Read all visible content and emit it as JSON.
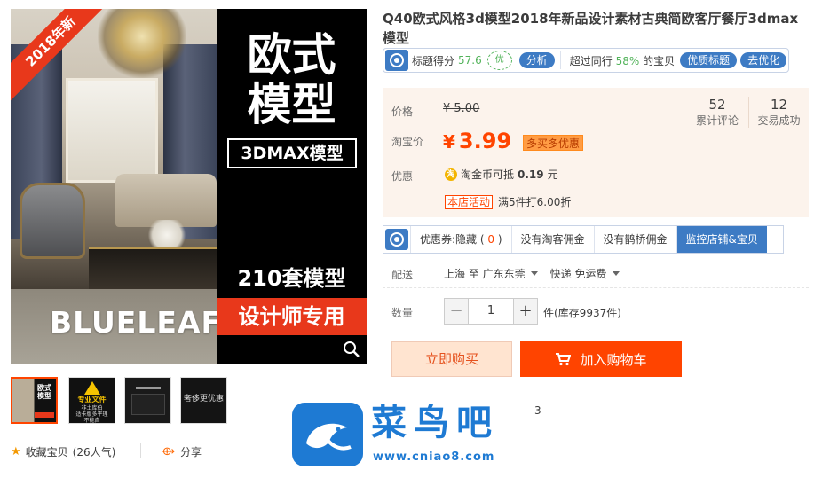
{
  "image": {
    "ribbon": "2018年新",
    "title_line1": "欧式",
    "title_line2": "模型",
    "badge": "3DMAX模型",
    "sets": "210套模型",
    "designer": "设计师专用",
    "brand": "BLUELEAF",
    "zoom_icon": "search-icon"
  },
  "thumbnails": [
    {
      "mini_line1": "欧式",
      "mini_line2": "模型"
    },
    {
      "line1": "专业文件",
      "line2": "非土库伯",
      "line3": "适卡版多平理",
      "line4": "不能自"
    },
    {
      "caption": ""
    },
    {
      "caption": "奢侈更优惠"
    }
  ],
  "actions": {
    "favorite": "收藏宝贝",
    "favorite_count": "(26人气)",
    "share": "分享"
  },
  "product": {
    "title": "Q40欧式风格3d模型2018年新品设计素材古典简欧客厅餐厅3dmax模型"
  },
  "tagbar": {
    "score_label": "标题得分",
    "score": "57.6",
    "badge": "优",
    "analyze": "分析",
    "beyond_label": "超过同行",
    "beyond_pct": "58%",
    "beyond_suffix": "的宝贝",
    "quality_title": "优质标题",
    "optimize": "去优化"
  },
  "price": {
    "price_label": "价格",
    "original": "¥ 5.00",
    "taobao_label": "淘宝价",
    "currency": "¥",
    "current": "3.99",
    "promo_tag": "多买多优惠",
    "reviews_count": "52",
    "reviews_label": "累计评论",
    "trades_count": "12",
    "trades_label": "交易成功",
    "discount_label": "优惠",
    "coin_icon": "淘",
    "coin_text": "淘金币可抵",
    "coin_amount": "0.19",
    "coin_unit": "元",
    "shop_activity": "本店活动",
    "shop_activity_desc": "满5件打6.00折"
  },
  "service": {
    "coupon": "优惠券:隐藏",
    "coupon_count": "0",
    "no_taoke": "没有淘客佣金",
    "no_queqiao": "没有鹊桥佣金",
    "monitor": "监控店铺&宝贝"
  },
  "delivery": {
    "label": "配送",
    "from": "上海 至",
    "to": "广东东莞",
    "method": "快递 免运费"
  },
  "quantity": {
    "label": "数量",
    "minus": "−",
    "value": "1",
    "plus": "+",
    "stock": "件(库存9937件)"
  },
  "buttons": {
    "buy_now": "立即购买",
    "add_cart": "加入购物车",
    "cart_icon": "cart-icon"
  },
  "watermark": {
    "name": "菜鸟吧",
    "url": "www.cniao8.com",
    "cut_text": "3"
  },
  "colors": {
    "accent": "#ff4400",
    "blue": "#3d7bc4",
    "green": "#52b35a",
    "price_bg": "#fcf3ec"
  }
}
